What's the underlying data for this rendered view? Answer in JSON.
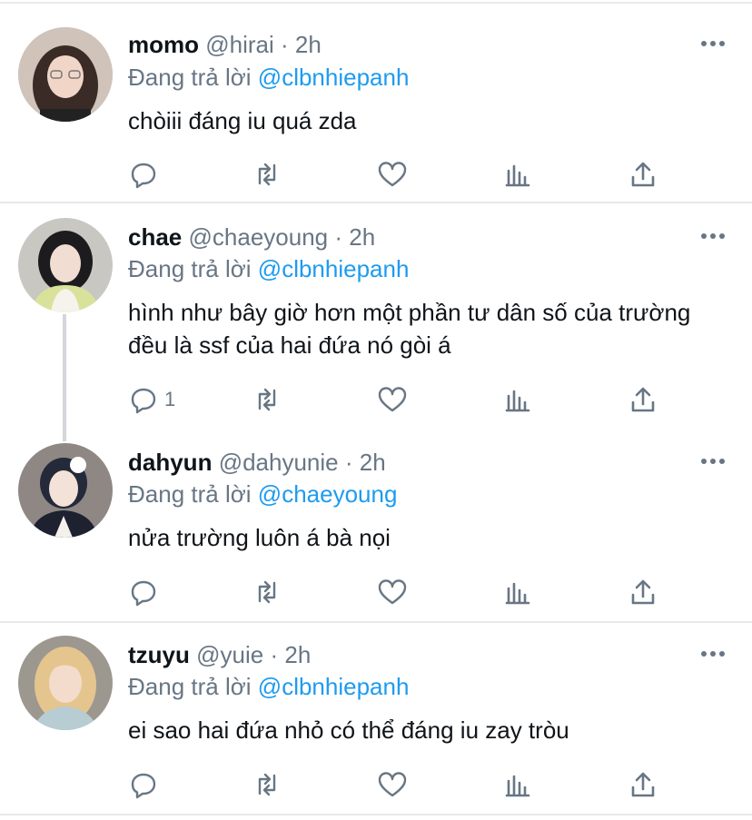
{
  "replying_label": "Đang trả lời",
  "tweets": [
    {
      "name": "momo",
      "handle": "@hirai",
      "sep": "·",
      "time": "2h",
      "reply_to": "@clbnhiepanh",
      "text": "chòiii đáng iu quá zda",
      "reply_count": ""
    },
    {
      "name": "chae",
      "handle": "@chaeyoung",
      "sep": "·",
      "time": "2h",
      "reply_to": "@clbnhiepanh",
      "text": "hình như bây giờ hơn một phần tư dân số của trường đều là ssf của hai đứa nó gòi á",
      "reply_count": "1"
    },
    {
      "name": "dahyun",
      "handle": "@dahyunie",
      "sep": "·",
      "time": "2h",
      "reply_to": "@chaeyoung",
      "text": "nửa trường luôn á bà nọi",
      "reply_count": ""
    },
    {
      "name": "tzuyu",
      "handle": "@yuie",
      "sep": "·",
      "time": "2h",
      "reply_to": "@clbnhiepanh",
      "text": "ei sao hai đứa nhỏ có thể đáng iu zay tròu",
      "reply_count": ""
    }
  ],
  "icons": {
    "reply": "reply-icon",
    "retweet": "retweet-icon",
    "like": "heart-icon",
    "analytics": "analytics-icon",
    "share": "share-icon",
    "more": "more-icon"
  },
  "colors": {
    "accent": "#1d9bf0",
    "muted": "#687684",
    "text": "#0f1419",
    "divider": "#e7e9ec"
  }
}
